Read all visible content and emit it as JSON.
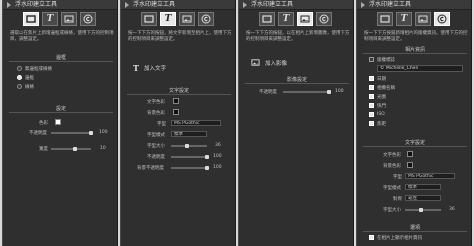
{
  "panels": [
    {
      "title": "浮水印建立工具",
      "desc": "選取以在焦片上新增邊框或線條，使用下方的控制項目，調整設定。",
      "border_title": "邊框",
      "radios": [
        "無邊框或線條",
        "邊框",
        "線條"
      ],
      "settings_title": "設定",
      "color_label": "色彩",
      "opacity_label": "不透明度",
      "opacity_value": "100",
      "size_label": "寬度",
      "size_value": "10"
    },
    {
      "title": "浮水印建立工具",
      "desc": "按一下下方的按鈕，將文字新增至相片上，使用下方的控制項目來調整設定。",
      "add_text_label": "加入文字",
      "text_settings_title": "文字設定",
      "text_color_label": "文字色彩",
      "bg_color_label": "背景色彩",
      "font_label": "字型",
      "font_value": "MS PGothic",
      "style_label": "字型樣式",
      "style_value": "標準",
      "font_size_label": "字型大小",
      "font_size_value": "36",
      "opacity_label": "不透明度",
      "opacity_value": "100",
      "bg_opacity_label": "背景不透明度",
      "bg_opacity_value": "100"
    },
    {
      "title": "浮水印建立工具",
      "desc": "按一下下方的按鈕，以在相片上新增圖像，使用下方的控制項目來調整設定。",
      "add_image_label": "加入影像",
      "image_settings_title": "影像設定",
      "opacity_label": "不透明度",
      "opacity_value": "100"
    },
    {
      "title": "浮水印建立工具",
      "desc": "按一下下方按鈕新增相片的版權資訊。使用下方的控制項目來調整設定。",
      "photo_info_title": "相片資訊",
      "copyright_label": "版權標誌",
      "copyright_value": "© Michelle_Chen",
      "checks": [
        "日期",
        "相機名稱",
        "光圈",
        "快門",
        "ISO",
        "焦距"
      ],
      "text_settings_title": "文字設定",
      "text_color_label": "文字色彩",
      "bg_color_label": "背景色彩",
      "font_label": "字型",
      "font_value": "MS PGothic",
      "style_label": "字型樣式",
      "style_value": "標準",
      "align_label": "對齊",
      "align_value": "靠左",
      "font_size_label": "字型大小",
      "font_size_value": "36",
      "options_title": "選項",
      "option_label": "在相片上顯示相片資訊"
    }
  ]
}
